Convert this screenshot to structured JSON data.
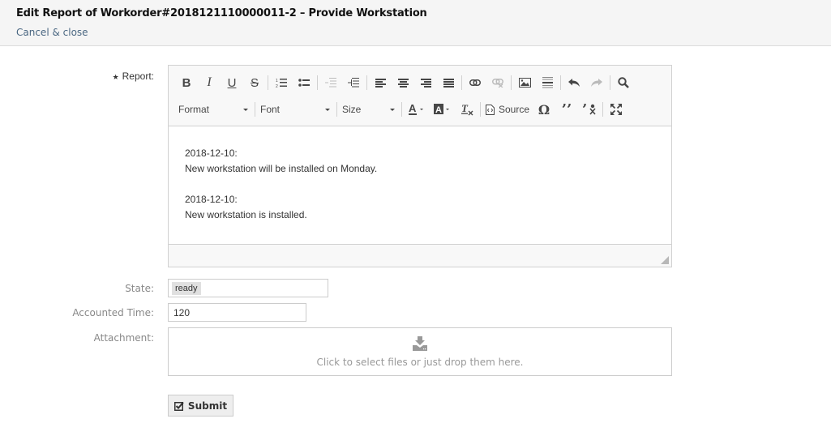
{
  "header": {
    "title": "Edit Report of Workorder#2018121110000011-2 – Provide Workstation",
    "cancel_label": "Cancel & close"
  },
  "form": {
    "report_label": "Report:",
    "report_required_marker": "★",
    "state_label": "State:",
    "accounted_time_label": "Accounted Time:",
    "attachment_label": "Attachment:"
  },
  "editor": {
    "toolbar_row1": [
      "bold",
      "italic",
      "underline",
      "strikethrough",
      "numbered-list",
      "bulleted-list",
      "decrease-indent",
      "increase-indent",
      "align-left",
      "align-center",
      "align-right",
      "justify",
      "link",
      "unlink",
      "image",
      "horizontal-line",
      "undo",
      "redo",
      "find"
    ],
    "format_label": "Format",
    "font_label": "Font",
    "size_label": "Size",
    "source_label": "Source",
    "content": [
      "2018-12-10:",
      "New workstation will be installed on Monday.",
      "",
      "2018-12-10:",
      "New workstation is installed."
    ]
  },
  "state": {
    "value": "ready"
  },
  "accounted_time": {
    "value": "120"
  },
  "attachment": {
    "hint": "Click to select files or just drop them here."
  },
  "submit_label": "Submit"
}
